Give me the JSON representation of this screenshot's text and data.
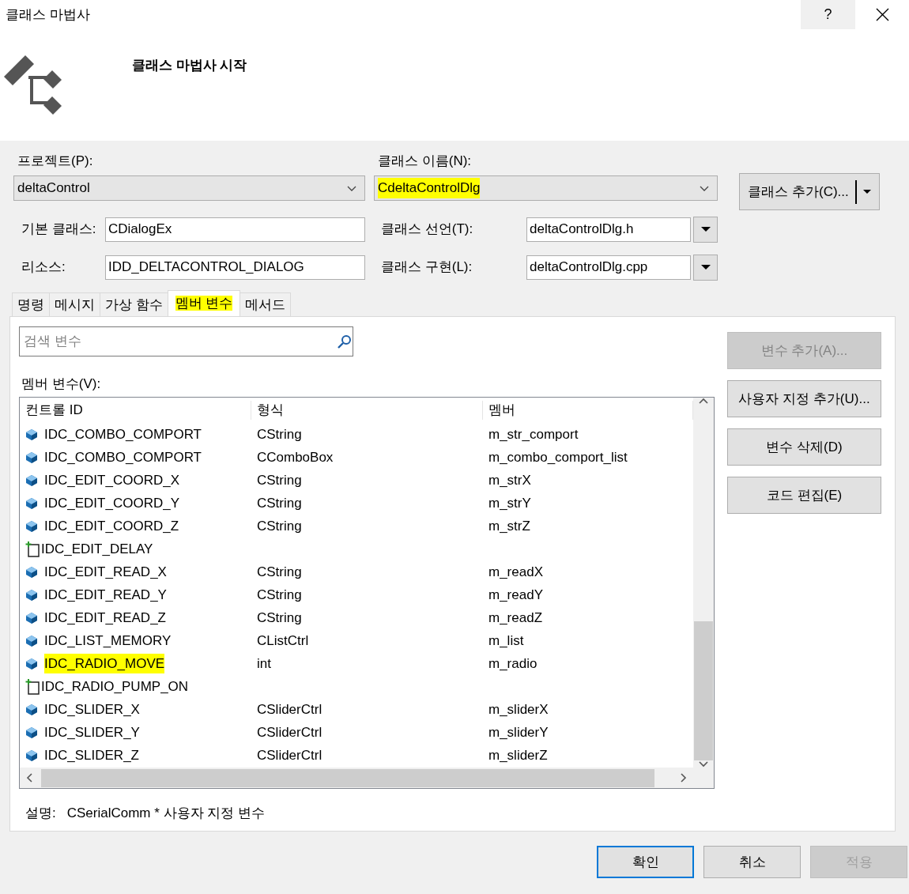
{
  "window": {
    "title": "클래스 마법사",
    "help": "?"
  },
  "header": {
    "title": "클래스 마법사 시작"
  },
  "project": {
    "label": "프로젝트(P):",
    "value": "deltaControl"
  },
  "class_name": {
    "label": "클래스 이름(N):",
    "value": "CdeltaControlDlg",
    "highlighted": true
  },
  "add_class_button": {
    "label": "클래스 추가(C)..."
  },
  "base_class": {
    "label": "기본 클래스:",
    "value": "CDialogEx"
  },
  "class_declaration": {
    "label": "클래스 선언(T):",
    "value": "deltaControlDlg.h"
  },
  "resource": {
    "label": "리소스:",
    "value": "IDD_DELTACONTROL_DIALOG"
  },
  "class_implementation": {
    "label": "클래스 구현(L):",
    "value": "deltaControlDlg.cpp"
  },
  "tabs": [
    {
      "label": "명령",
      "selected": false,
      "highlighted": false
    },
    {
      "label": "메시지",
      "selected": false,
      "highlighted": false
    },
    {
      "label": "가상 함수",
      "selected": false,
      "highlighted": false
    },
    {
      "label": "멤버 변수",
      "selected": true,
      "highlighted": true
    },
    {
      "label": "메서드",
      "selected": false,
      "highlighted": false
    }
  ],
  "search": {
    "placeholder": "검색 변수"
  },
  "list_label": "멤버 변수(V):",
  "table": {
    "columns": [
      "컨트롤 ID",
      "형식",
      "멤버"
    ],
    "rows": [
      {
        "kind": "variable",
        "id": "IDC_COMBO_COMPORT",
        "type": "CString",
        "member": "m_str_comport",
        "highlighted": false
      },
      {
        "kind": "variable",
        "id": "IDC_COMBO_COMPORT",
        "type": "CComboBox",
        "member": "m_combo_comport_list",
        "highlighted": false
      },
      {
        "kind": "variable",
        "id": "IDC_EDIT_COORD_X",
        "type": "CString",
        "member": "m_strX",
        "highlighted": false
      },
      {
        "kind": "variable",
        "id": "IDC_EDIT_COORD_Y",
        "type": "CString",
        "member": "m_strY",
        "highlighted": false
      },
      {
        "kind": "variable",
        "id": "IDC_EDIT_COORD_Z",
        "type": "CString",
        "member": "m_strZ",
        "highlighted": false
      },
      {
        "kind": "unbound",
        "id": "IDC_EDIT_DELAY",
        "highlighted": false
      },
      {
        "kind": "variable",
        "id": "IDC_EDIT_READ_X",
        "type": "CString",
        "member": "m_readX",
        "highlighted": false
      },
      {
        "kind": "variable",
        "id": "IDC_EDIT_READ_Y",
        "type": "CString",
        "member": "m_readY",
        "highlighted": false
      },
      {
        "kind": "variable",
        "id": "IDC_EDIT_READ_Z",
        "type": "CString",
        "member": "m_readZ",
        "highlighted": false
      },
      {
        "kind": "variable",
        "id": "IDC_LIST_MEMORY",
        "type": "CListCtrl",
        "member": "m_list",
        "highlighted": false
      },
      {
        "kind": "variable",
        "id": "IDC_RADIO_MOVE",
        "type": "int",
        "member": "m_radio",
        "highlighted": true
      },
      {
        "kind": "unbound",
        "id": "IDC_RADIO_PUMP_ON",
        "highlighted": false
      },
      {
        "kind": "variable",
        "id": "IDC_SLIDER_X",
        "type": "CSliderCtrl",
        "member": "m_sliderX",
        "highlighted": false
      },
      {
        "kind": "variable",
        "id": "IDC_SLIDER_Y",
        "type": "CSliderCtrl",
        "member": "m_sliderY",
        "highlighted": false
      },
      {
        "kind": "variable",
        "id": "IDC_SLIDER_Z",
        "type": "CSliderCtrl",
        "member": "m_sliderZ",
        "highlighted": false
      }
    ]
  },
  "side_buttons": [
    {
      "label": "변수 추가(A)...",
      "disabled": true
    },
    {
      "label": "사용자 지정 추가(U)...",
      "disabled": false
    },
    {
      "label": "변수 삭제(D)",
      "disabled": false
    },
    {
      "label": "코드 편집(E)",
      "disabled": false
    }
  ],
  "description": {
    "label": "설명:",
    "value": "CSerialComm * 사용자 지정 변수"
  },
  "footer_buttons": [
    {
      "label": "확인",
      "default": true,
      "disabled": false
    },
    {
      "label": "취소",
      "default": false,
      "disabled": false
    },
    {
      "label": "적용",
      "default": false,
      "disabled": true
    }
  ]
}
